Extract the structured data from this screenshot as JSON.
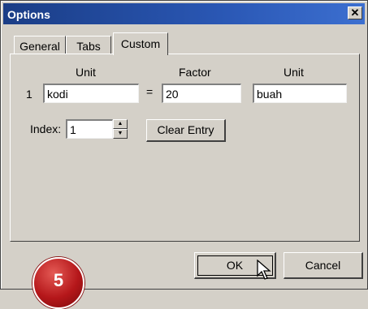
{
  "window": {
    "title": "Options",
    "close_glyph": "✕"
  },
  "tabs": [
    {
      "label": "General",
      "active": false
    },
    {
      "label": "Tabs",
      "active": false
    },
    {
      "label": "Custom",
      "active": true
    }
  ],
  "custom": {
    "headers": {
      "unit_left": "Unit",
      "factor": "Factor",
      "unit_right": "Unit"
    },
    "row_number": "1",
    "unit_from": "kodi",
    "equals": "=",
    "factor": "20",
    "unit_to": "buah",
    "index_label": "Index:",
    "index_value": "1",
    "clear_entry_label": "Clear Entry"
  },
  "buttons": {
    "ok": "OK",
    "cancel": "Cancel"
  },
  "badge": {
    "number": "5",
    "color": "#c0181c"
  },
  "colors": {
    "titlebar": "#1a3d86",
    "face": "#d4d0c8"
  }
}
